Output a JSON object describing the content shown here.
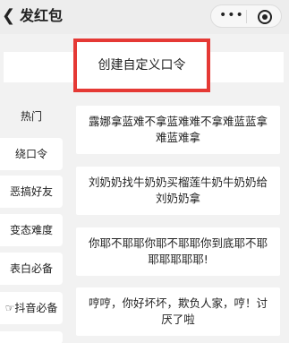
{
  "header": {
    "back_icon": "chevron-left-icon",
    "title": "发红包",
    "more_label": "•••",
    "close_icon": "record-circle-icon"
  },
  "custom": {
    "label": "创建自定义口令",
    "highlight_color": "#e53935"
  },
  "sidebar": {
    "items": [
      {
        "label": "热门"
      },
      {
        "label": "绕口令"
      },
      {
        "label": "恶搞好友"
      },
      {
        "label": "变态难度"
      },
      {
        "label": "表白必备"
      },
      {
        "label": "☞抖音必备"
      }
    ]
  },
  "cards": [
    {
      "text": "露娜拿蓝难不拿蓝难难不拿难蓝蓝拿难蓝难拿"
    },
    {
      "text": "刘奶奶找牛奶奶买榴莲牛奶牛奶奶给刘奶奶拿"
    },
    {
      "text": "你耶不耶耶你耶不耶耶你到底耶不耶耶耶耶耶耶!"
    },
    {
      "text": "哼哼，你好坏坏，欺负人家，哼！讨厌了啦"
    }
  ]
}
